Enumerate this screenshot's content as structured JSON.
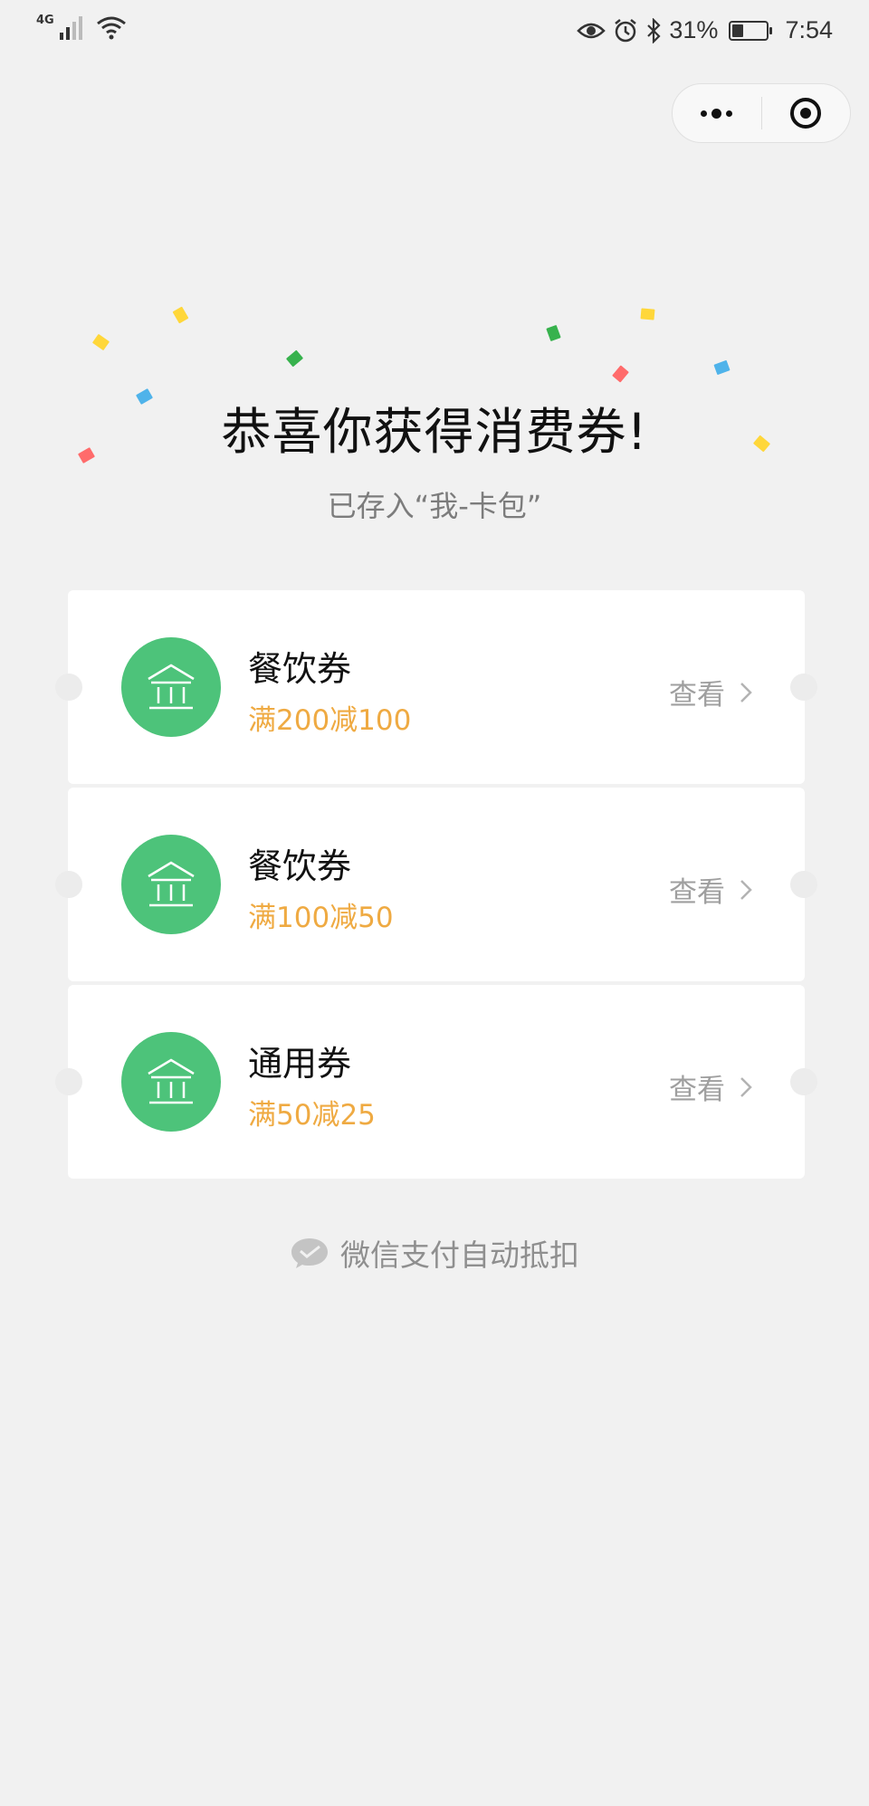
{
  "status_bar": {
    "network": "4G",
    "battery": "31%",
    "battery_level": 0.31,
    "time": "7:54",
    "icons": [
      "signal-icon",
      "wifi-icon",
      "eye-icon",
      "alarm-icon",
      "bluetooth-icon",
      "battery-icon"
    ]
  },
  "capsule": {
    "more_icon": "more-dots-icon",
    "close_icon": "close-target-icon"
  },
  "hero": {
    "title": "恭喜你获得消费券!",
    "subtitle": "已存入“我-卡包”"
  },
  "confetti_colors": [
    "#ffd73a",
    "#4fb3ea",
    "#ff6b6b",
    "#37b24d"
  ],
  "coupons": [
    {
      "icon": "bank-icon",
      "title": "餐饮券",
      "rule": "满200减100",
      "action": "查看"
    },
    {
      "icon": "bank-icon",
      "title": "餐饮券",
      "rule": "满100减50",
      "action": "查看"
    },
    {
      "icon": "bank-icon",
      "title": "通用券",
      "rule": "满50减25",
      "action": "查看"
    }
  ],
  "footer": {
    "icon": "wechat-pay-icon",
    "text": "微信支付自动抵扣"
  },
  "colors": {
    "accent_green": "#4dc37a",
    "rule_orange": "#efaa42",
    "background": "#f1f1f1"
  }
}
